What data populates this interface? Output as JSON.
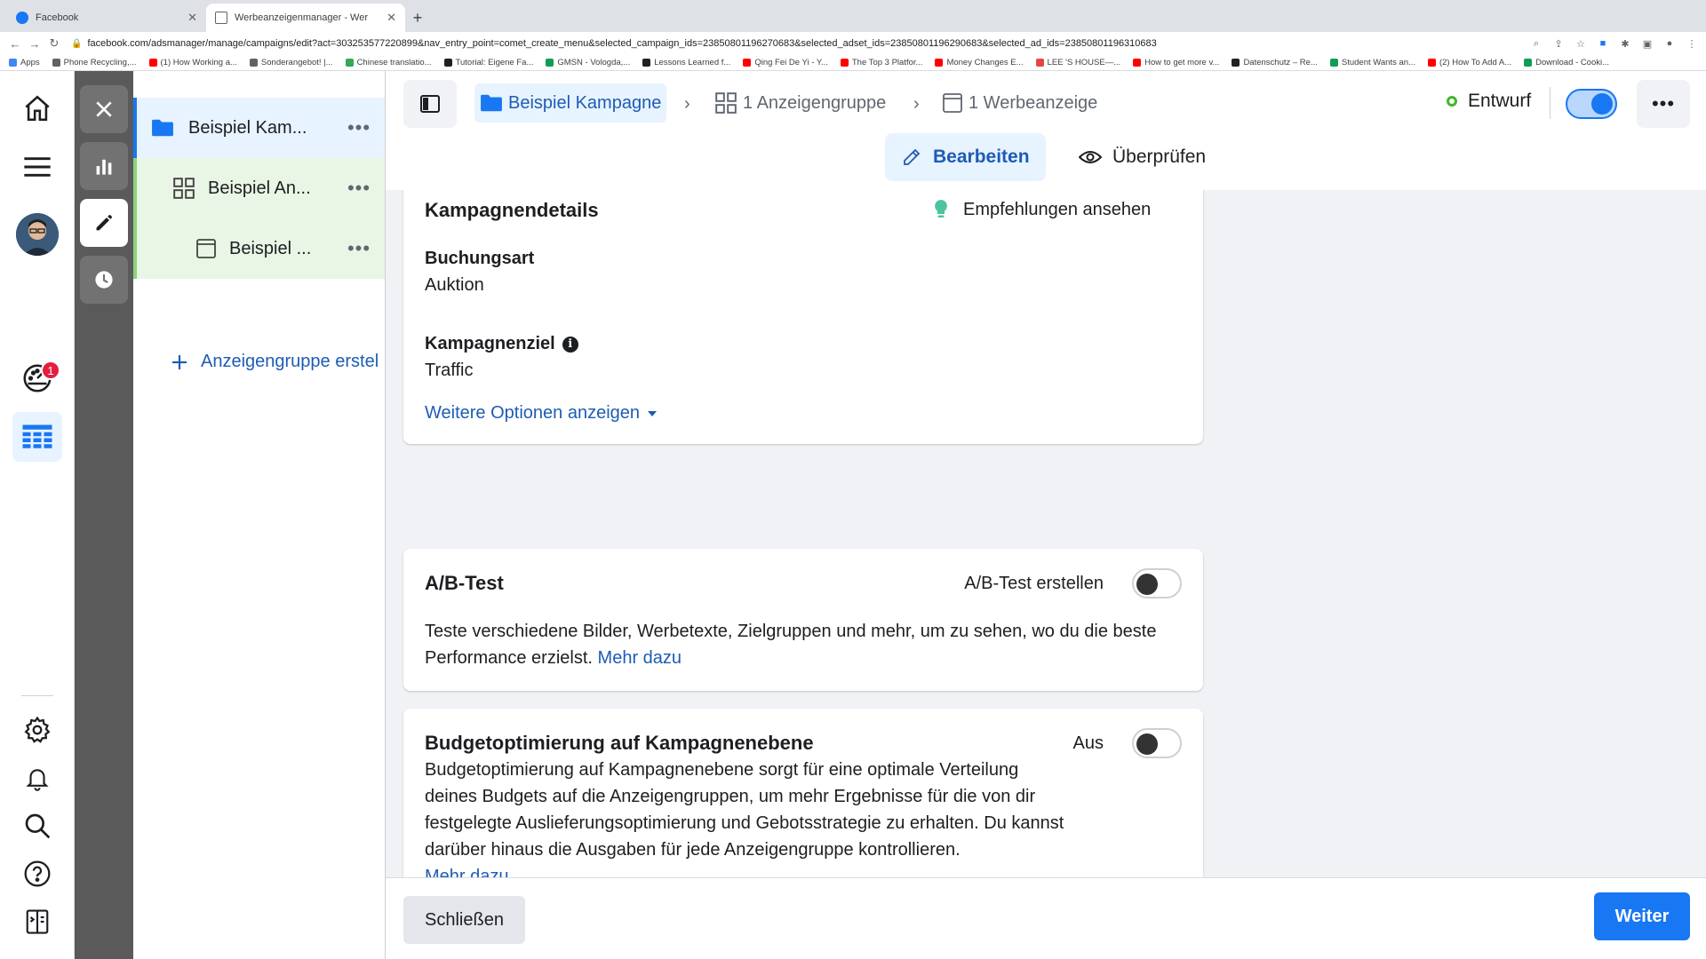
{
  "browser": {
    "tabs": [
      {
        "title": "Facebook",
        "icon": "facebook-icon"
      },
      {
        "title": "Werbeanzeigenmanager - Wer",
        "icon": "ads-manager-icon"
      }
    ],
    "url": "facebook.com/adsmanager/manage/campaigns/edit?act=303253577220899&nav_entry_point=comet_create_menu&selected_campaign_ids=23850801196270683&selected_adset_ids=23850801196290683&selected_ad_ids=23850801196310683",
    "bookmarks": [
      {
        "label": "Apps",
        "color": "#4285f4"
      },
      {
        "label": "Phone Recycling,...",
        "color": "#5f6368"
      },
      {
        "label": "(1) How Working a...",
        "color": "#ff0000"
      },
      {
        "label": "Sonderangebot! |...",
        "color": "#5f6368"
      },
      {
        "label": "Chinese translatio...",
        "color": "#34a853"
      },
      {
        "label": "Tutorial: Eigene Fa...",
        "color": "#202124"
      },
      {
        "label": "GMSN - Vologda,...",
        "color": "#0f9d58"
      },
      {
        "label": "Lessons Learned f...",
        "color": "#202124"
      },
      {
        "label": "Qing Fei De Yi - Y...",
        "color": "#ff0000"
      },
      {
        "label": "The Top 3 Platfor...",
        "color": "#ff0000"
      },
      {
        "label": "Money Changes E...",
        "color": "#ff0000"
      },
      {
        "label": "LEE 'S HOUSE—...",
        "color": "#e8453c"
      },
      {
        "label": "How to get more v...",
        "color": "#ff0000"
      },
      {
        "label": "Datenschutz – Re...",
        "color": "#202124"
      },
      {
        "label": "Student Wants an...",
        "color": "#0f9d58"
      },
      {
        "label": "(2) How To Add A...",
        "color": "#ff0000"
      },
      {
        "label": "Download - Cooki...",
        "color": "#0f9d58"
      }
    ]
  },
  "rail": {
    "notification_count": "1"
  },
  "tree": {
    "campaign": "Beispiel Kam...",
    "adset": "Beispiel An...",
    "ad": "Beispiel ...",
    "add_label": "Anzeigengruppe erstel",
    "more": "•••"
  },
  "header": {
    "crumb_campaign": "Beispiel Kampagne",
    "crumb_adset": "1 Anzeigengruppe",
    "crumb_ad": "1 Werbeanzeige",
    "status": "Entwurf",
    "more": "•••",
    "tab_edit": "Bearbeiten",
    "tab_review": "Überprüfen"
  },
  "details": {
    "title": "Kampagnendetails",
    "recommendations": "Empfehlungen ansehen",
    "buying_type_label": "Buchungsart",
    "buying_type_value": "Auktion",
    "objective_label": "Kampagnenziel",
    "objective_value": "Traffic",
    "more_options": "Weitere Optionen anzeigen"
  },
  "abtest": {
    "title": "A/B-Test",
    "toggle_label": "A/B-Test erstellen",
    "description": "Teste verschiedene Bilder, Werbetexte, Zielgruppen und mehr, um zu sehen, wo du die beste Performance erzielst.",
    "link": "Mehr dazu"
  },
  "budget": {
    "title": "Budgetoptimierung auf Kampagnenebene",
    "toggle_label": "Aus",
    "description": "Budgetoptimierung auf Kampagnenebene sorgt für eine optimale Verteilung deines Budgets auf die Anzeigengruppen, um mehr Ergebnisse für die von dir festgelegte Auslieferungsoptimierung und Gebotsstrategie zu erhalten. Du kannst darüber hinaus die Ausgaben für jede Anzeigengruppe kontrollieren.",
    "link": "Mehr dazu"
  },
  "footer": {
    "close": "Schließen",
    "next": "Weiter"
  },
  "colors": {
    "accent": "#1877f2",
    "link": "#1d5cb5",
    "draft_status": "#42b72a"
  }
}
